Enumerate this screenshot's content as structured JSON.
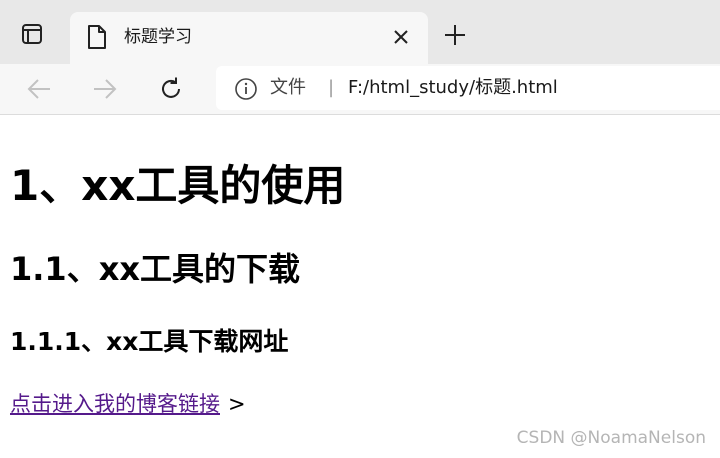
{
  "browser": {
    "tab": {
      "title": "标题学习",
      "icons": {
        "page": "page-icon",
        "close": "close-icon"
      }
    },
    "toolbar": {
      "address_label": "文件",
      "address_separator": "|",
      "url": "F:/html_study/标题.html",
      "icons": {
        "tab_actions": "tab-actions-icon",
        "new_tab": "plus-icon",
        "back": "arrow-left-icon",
        "forward": "arrow-right-icon",
        "reload": "reload-icon",
        "info": "info-icon"
      }
    }
  },
  "page": {
    "h1": "1、xx工具的使用",
    "h2": "1.1、xx工具的下载",
    "h3": "1.1.1、xx工具下载网址",
    "link_text": "点击进入我的博客链接",
    "link_suffix": ">"
  },
  "watermark": "CSDN @NoamaNelson",
  "colors": {
    "tabbar_bg": "#e8e8e8",
    "toolbar_bg": "#f7f7f7",
    "visited_link": "#551a8b"
  }
}
